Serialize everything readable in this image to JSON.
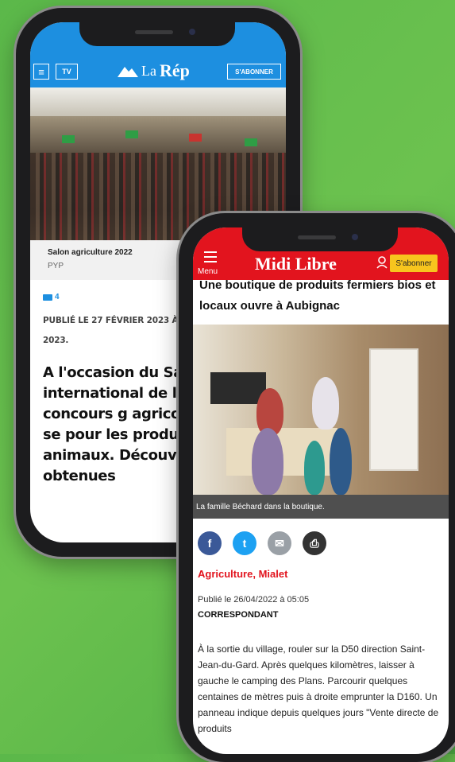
{
  "phone1": {
    "header": {
      "menu_icon": "≡",
      "tv_label": "TV",
      "logo_text_small": "La",
      "logo_text_big": "Rép",
      "subscribe_label": "S'ABONNER",
      "color": "#1d8fe0"
    },
    "photo_caption": {
      "title": "Salon agriculture 2022",
      "credit": "PYP"
    },
    "comments_count": "4",
    "published": "PUBLIÉ LE 27 FÉVRIER 2023 À 12H25",
    "published_tail": "2023.",
    "lead": "A l'occasion du Salon international de l'a Paris, le concours g agricole distribue se pour les produits, le animaux. Découvre médailles obtenues"
  },
  "phone2": {
    "header": {
      "menu_label": "Menu",
      "logo": "Midi Libre",
      "user_icon": "user-icon",
      "subscribe_label": "S'abonner",
      "color": "#e2141e"
    },
    "title": "Une boutique de produits fermiers bios et locaux ouvre à Aubignac",
    "photo_caption": "La famille Béchard dans la boutique.",
    "share": [
      {
        "name": "facebook-icon",
        "glyph": "f",
        "color": "#3b5998"
      },
      {
        "name": "twitter-icon",
        "glyph": "t",
        "color": "#1da1f2"
      },
      {
        "name": "email-icon",
        "glyph": "✉",
        "color": "#9aa0a6"
      },
      {
        "name": "print-icon",
        "glyph": "⎙",
        "color": "#333333"
      }
    ],
    "categories": "Agriculture, Mialet",
    "published": "Publié le 26/04/2022 à 05:05",
    "author": "CORRESPONDANT",
    "body": "À la sortie du village, rouler sur la D50 direction Saint-Jean-du-Gard. Après quelques kilomètres, laisser à gauche le camping des Plans. Parcourir quelques centaines de mètres puis à droite emprunter la D160. Un panneau indique depuis quelques jours \"Vente directe de produits"
  }
}
